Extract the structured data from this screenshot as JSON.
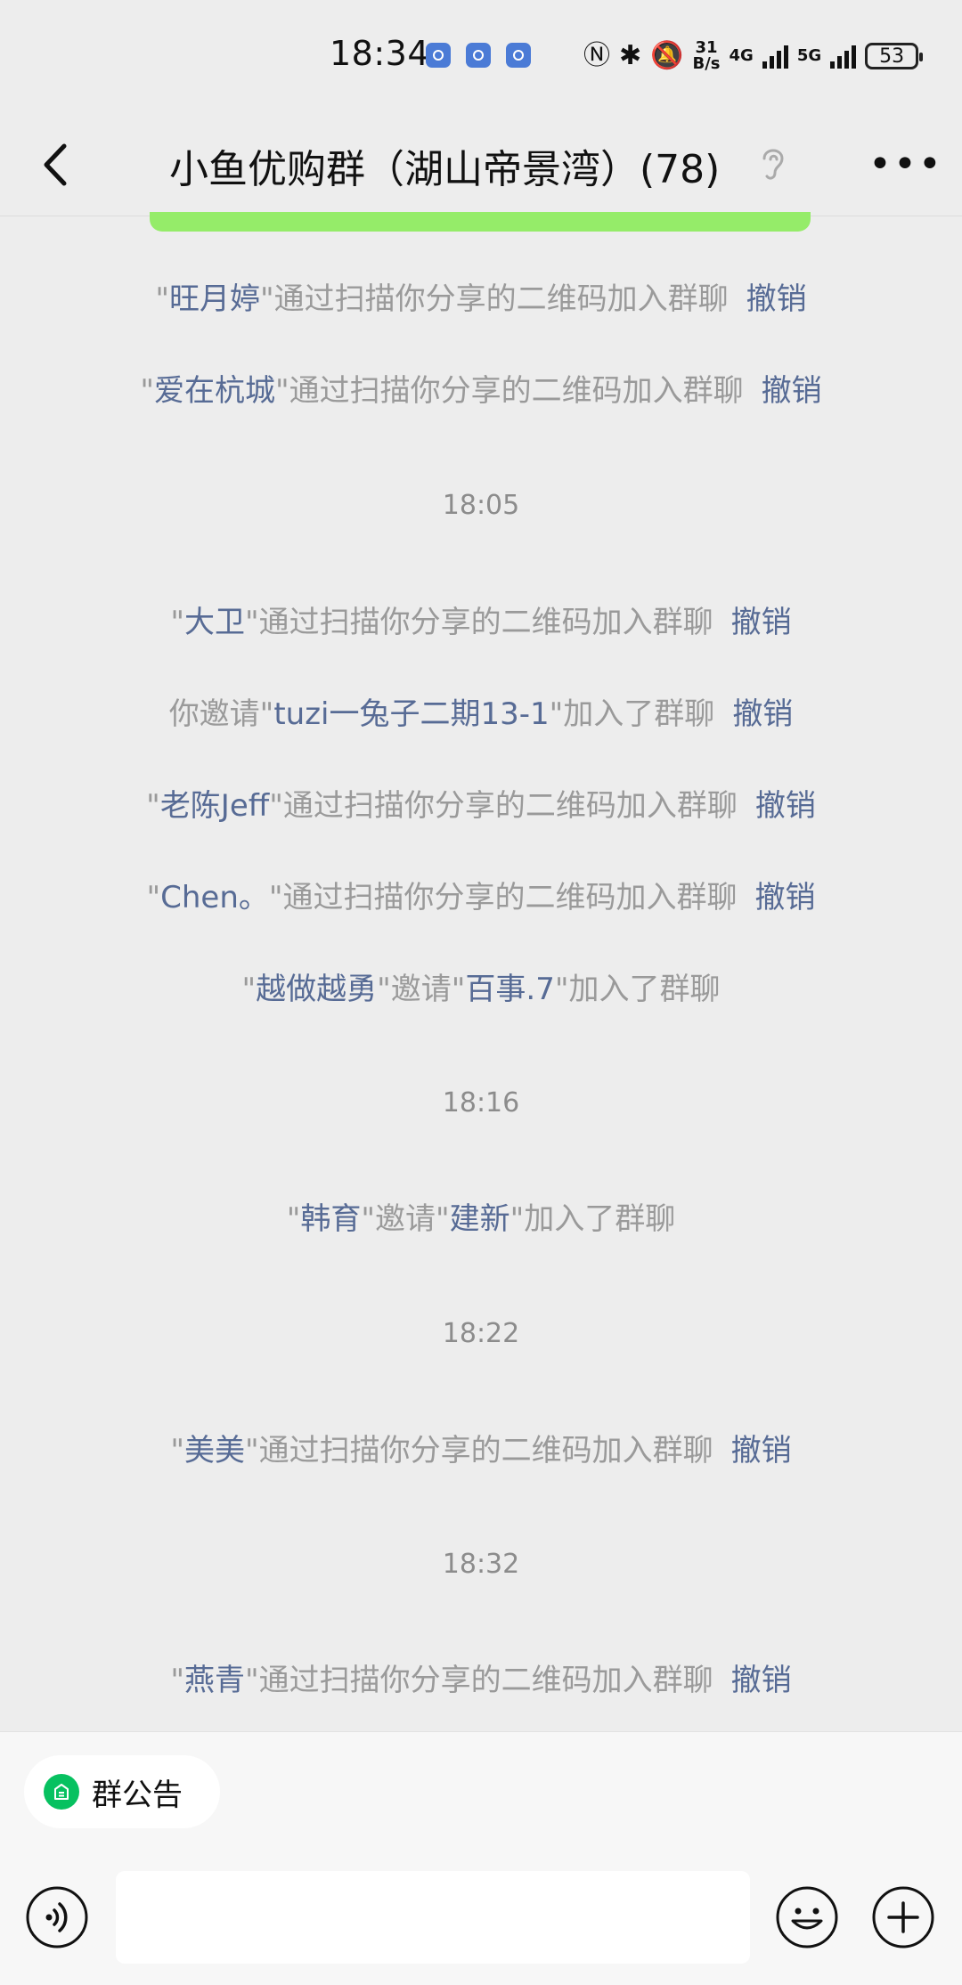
{
  "status_bar": {
    "time": "18:34",
    "speed_top": "31",
    "speed_bottom": "B/s",
    "net1": "4G",
    "net2": "5G",
    "battery": "53"
  },
  "header": {
    "title": "小鱼优购群（湖山帝景湾）(78)"
  },
  "chat": {
    "revoke_label": "撤销",
    "times": [
      "18:05",
      "18:16",
      "18:22",
      "18:32"
    ],
    "messages": [
      {
        "q1": "\"",
        "name": "旺月婷",
        "q2": "\"",
        "text": "通过扫描你分享的二维码加入群聊"
      },
      {
        "q1": "\"",
        "name": "爱在杭城",
        "q2": "\"",
        "text": "通过扫描你分享的二维码加入群聊"
      },
      {
        "q1": "\"",
        "name": "大卫",
        "q2": "\"",
        "text": "通过扫描你分享的二维码加入群聊"
      },
      {
        "pre": "你邀请\"",
        "name": "tuzi一兔子二期13-1",
        "post": "\"加入了群聊"
      },
      {
        "q1": "\"",
        "name": "老陈Jeff",
        "q2": "\"",
        "text": "通过扫描你分享的二维码加入群聊"
      },
      {
        "q1": "\"",
        "name": "Chen。",
        "q2": "\"",
        "text": "通过扫描你分享的二维码加入群聊"
      },
      {
        "q1": "\"",
        "name": "越做越勇",
        "mid": "\"邀请\"",
        "name2": "百事.7",
        "post": "\"加入了群聊"
      },
      {
        "q1": "\"",
        "name": "韩育",
        "mid": "\"邀请\"",
        "name2": "建新",
        "post": "\"加入了群聊"
      },
      {
        "q1": "\"",
        "name": "美美",
        "q2": "\"",
        "text": "通过扫描你分享的二维码加入群聊"
      },
      {
        "q1": "\"",
        "name": "燕青",
        "q2": "\"",
        "text": "通过扫描你分享的二维码加入群聊"
      }
    ]
  },
  "bottom": {
    "announcement_label": "群公告",
    "input_value": "",
    "input_placeholder": ""
  },
  "icons": {
    "back": "chevron-left-icon",
    "ear": "ear-icon",
    "more": "more-dots-icon",
    "voice": "voice-icon",
    "emoji": "emoji-icon",
    "plus": "plus-icon"
  },
  "colors": {
    "background": "#ededed",
    "name_link": "#576b95",
    "system_text": "#9a9a9a",
    "green_strip": "#95ec69",
    "announcement_icon": "#07c160"
  }
}
